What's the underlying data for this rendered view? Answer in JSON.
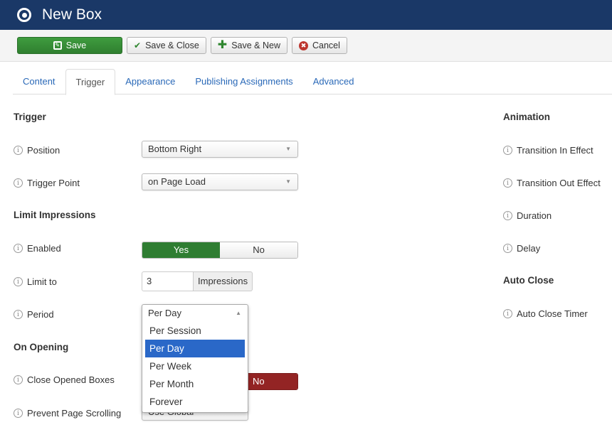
{
  "header": {
    "title": "New Box",
    "icon": "radio-target-icon"
  },
  "toolbar": {
    "save_label": "Save",
    "save_close_label": "Save & Close",
    "save_new_label": "Save & New",
    "cancel_label": "Cancel"
  },
  "tabs": [
    {
      "label": "Content",
      "active": false
    },
    {
      "label": "Trigger",
      "active": true
    },
    {
      "label": "Appearance",
      "active": false
    },
    {
      "label": "Publishing Assignments",
      "active": false
    },
    {
      "label": "Advanced",
      "active": false
    }
  ],
  "trigger": {
    "title": "Trigger",
    "position": {
      "label": "Position",
      "value": "Bottom Right"
    },
    "trigger_point": {
      "label": "Trigger Point",
      "value": "on Page Load"
    }
  },
  "limit_impressions": {
    "title": "Limit Impressions",
    "enabled": {
      "label": "Enabled",
      "yes": "Yes",
      "no": "No",
      "value": "Yes"
    },
    "limit_to": {
      "label": "Limit to",
      "value": "3",
      "addon": "Impressions"
    },
    "period": {
      "label": "Period",
      "value": "Per Day",
      "options": [
        "Per Session",
        "Per Day",
        "Per Week",
        "Per Month",
        "Forever"
      ]
    }
  },
  "on_opening": {
    "title": "On Opening",
    "close_opened_boxes": {
      "label": "Close Opened Boxes",
      "value": "No",
      "no": "No"
    },
    "prevent_page_scrolling": {
      "label": "Prevent Page Scrolling",
      "value": "Use Global"
    }
  },
  "animation": {
    "title": "Animation",
    "fields": [
      "Transition In Effect",
      "Transition Out Effect",
      "Duration",
      "Delay"
    ]
  },
  "auto_close": {
    "title": "Auto Close",
    "fields": [
      "Auto Close Timer"
    ]
  },
  "colors": {
    "header_bg": "#1a3867",
    "save_green": "#2f7f2f",
    "toggle_yes_green": "#2f7d32",
    "toggle_no_red": "#932424",
    "link_blue": "#2a69b8",
    "dropdown_highlight": "#2a68c8"
  }
}
